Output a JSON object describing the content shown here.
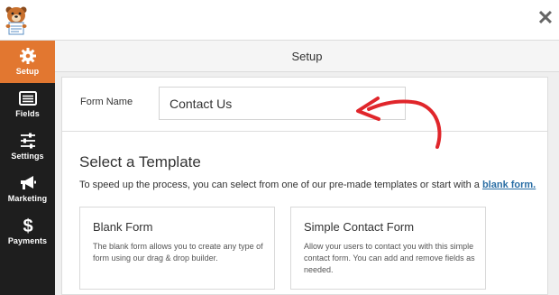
{
  "header": {
    "logo_icon": "bear-mascot-logo-icon",
    "close_icon": "close-icon",
    "close_glyph": "✕"
  },
  "sidebar": {
    "items": [
      {
        "label": "Setup",
        "icon": "gear-icon",
        "active": true
      },
      {
        "label": "Fields",
        "icon": "list-icon",
        "active": false
      },
      {
        "label": "Settings",
        "icon": "sliders-icon",
        "active": false
      },
      {
        "label": "Marketing",
        "icon": "megaphone-icon",
        "active": false
      },
      {
        "label": "Payments",
        "icon": "dollar-icon",
        "active": false
      }
    ]
  },
  "titlebar": {
    "title": "Setup"
  },
  "form": {
    "name_label": "Form Name",
    "name_value": "Contact Us"
  },
  "templates": {
    "title": "Select a Template",
    "description_prefix": "To speed up the process, you can select from one of our pre-made templates or start with a ",
    "description_link": "blank form.",
    "cards": [
      {
        "title": "Blank Form",
        "description": "The blank form allows you to create any type of form using our drag & drop builder."
      },
      {
        "title": "Simple Contact Form",
        "description": "Allow your users to contact you with this simple contact form. You can add and remove fields as needed."
      }
    ]
  },
  "colors": {
    "accent": "#e27730",
    "sidebar_bg": "#1e1e1e",
    "link": "#2a6ea5",
    "annotation_arrow": "#e0262b"
  }
}
